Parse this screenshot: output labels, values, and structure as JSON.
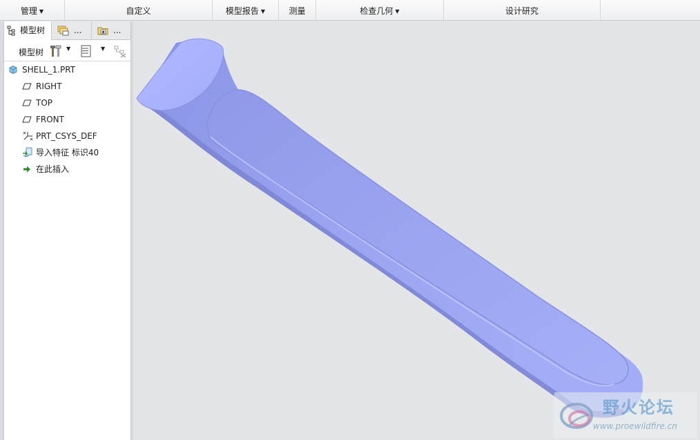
{
  "ribbon": {
    "groups": [
      {
        "label": "管理",
        "dropdown": true
      },
      {
        "label": "自定义",
        "dropdown": false
      },
      {
        "label": "模型报告",
        "dropdown": true
      },
      {
        "label": "测量",
        "dropdown": false
      },
      {
        "label": "检查几何",
        "dropdown": true
      },
      {
        "label": "设计研究",
        "dropdown": false
      }
    ]
  },
  "panel": {
    "tabs": [
      {
        "label": "模型树",
        "icon": "model-tree-icon"
      },
      {
        "label": "...",
        "icon": "folder-layers-icon"
      },
      {
        "label": "...",
        "icon": "favorites-folder-icon"
      }
    ],
    "toolbar": {
      "label": "模型树"
    },
    "tree": [
      {
        "label": "SHELL_1.PRT",
        "icon": "part-icon"
      },
      {
        "label": "RIGHT",
        "icon": "datum-plane-icon"
      },
      {
        "label": "TOP",
        "icon": "datum-plane-icon"
      },
      {
        "label": "FRONT",
        "icon": "datum-plane-icon"
      },
      {
        "label": "PRT_CSYS_DEF",
        "icon": "csys-icon"
      },
      {
        "label": "导入特征 标识40",
        "icon": "import-feature-icon"
      },
      {
        "label": "在此插入",
        "icon": "insert-arrow-icon"
      }
    ]
  },
  "colors": {
    "model": "#9ea8f2",
    "model_dark": "#7e88d6",
    "accent": "#2a6fb5"
  },
  "watermark": {
    "cn": "野火论坛",
    "url": "www.proewildfire.cn"
  }
}
